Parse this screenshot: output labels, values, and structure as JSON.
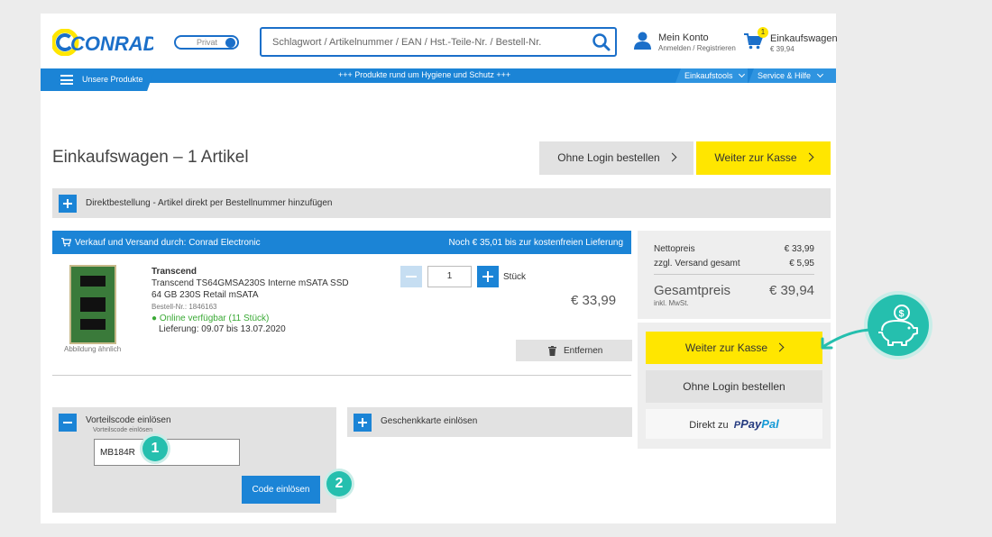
{
  "header": {
    "brand": "CONRAD",
    "toggle_label": "Privat",
    "search_placeholder": "Schlagwort / Artikelnummer / EAN / Hst.-Teile-Nr. / Bestell-Nr.",
    "account_title": "Mein Konto",
    "account_sub": "Anmelden / Registrieren",
    "cart_title": "Einkaufswagen",
    "cart_amount": "€ 39,94",
    "cart_count": "1"
  },
  "navbar": {
    "products_label": "Unsere Produkte",
    "promo": "+++ Produkte rund um Hygiene und Schutz +++",
    "tools_label": "Einkaufstools",
    "service_label": "Service & Hilfe"
  },
  "main": {
    "title": "Einkaufswagen – 1 Artikel",
    "btn_no_login": "Ohne Login bestellen",
    "btn_checkout": "Weiter zur Kasse",
    "direct_order": "Direktbestellung - Artikel direkt per Bestellnummer hinzufügen",
    "seller_left": "Verkauf und Versand durch: Conrad Electronic",
    "seller_right": "Noch € 35,01 bis zur kostenfreien Lieferung"
  },
  "product": {
    "brand": "Transcend",
    "name": "Transcend TS64GMSA230S Interne mSATA SSD 64 GB 230S Retail mSATA",
    "order_no": "Bestell-Nr.: 1846163",
    "availability": "● Online verfügbar (11 Stück)",
    "delivery": "Lieferung: 09.07 bis 13.07.2020",
    "image_caption": "Abbildung ähnlich",
    "qty": "1",
    "unit": "Stück",
    "price": "€ 33,99",
    "remove_label": "Entfernen"
  },
  "summary": {
    "net_label": "Nettopreis",
    "net_value": "€ 33,99",
    "shipping_label": "zzgl. Versand gesamt",
    "shipping_value": "€ 5,95",
    "total_label": "Gesamtpreis",
    "total_value": "€ 39,94",
    "vat_note": "inkl. MwSt.",
    "btn_checkout": "Weiter zur Kasse",
    "btn_no_login": "Ohne Login bestellen",
    "paypal_prefix": "Direkt zu",
    "paypal_pay": "Pay",
    "paypal_pal": "Pal"
  },
  "voucher": {
    "title": "Vorteilscode einlösen",
    "field_label": "Vorteilscode einlösen",
    "field_value": "MB184R",
    "button": "Code einlösen",
    "gift_title": "Geschenkkarte einlösen"
  },
  "steps": {
    "one": "1",
    "two": "2"
  },
  "colors": {
    "blue": "#1b84d6",
    "yellow": "#ffe600",
    "teal": "#25bfae",
    "green": "#3aa935"
  }
}
